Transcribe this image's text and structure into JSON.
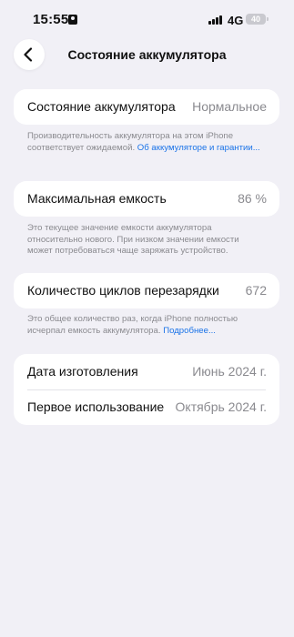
{
  "status_bar": {
    "time": "15:55",
    "network": "4G",
    "battery_level": "40"
  },
  "nav": {
    "title": "Состояние аккумулятора"
  },
  "battery_health": {
    "label": "Состояние аккумулятора",
    "value": "Нормальное",
    "note": "Производительность аккумулятора на этом iPhone соответствует ожидаемой.",
    "link": "Об аккумуляторе и гарантии..."
  },
  "max_capacity": {
    "label": "Максимальная емкость",
    "value": "86 %",
    "note": "Это текущее значение емкости аккумулятора относительно нового. При низком значении емкости может потребоваться чаще заряжать устройство."
  },
  "cycle_count": {
    "label": "Количество циклов перезарядки",
    "value": "672",
    "note": "Это общее количество раз, когда iPhone полностью исчерпал емкость аккумулятора.",
    "link": "Подробнее..."
  },
  "dates": {
    "manufacture_label": "Дата изготовления",
    "manufacture_value": "Июнь 2024 г.",
    "first_use_label": "Первое использование",
    "first_use_value": "Октябрь 2024 г."
  },
  "colors": {
    "background": "#f1f0f6",
    "card": "#ffffff",
    "secondary_text": "#8a8a8f",
    "link": "#1a73e8"
  }
}
